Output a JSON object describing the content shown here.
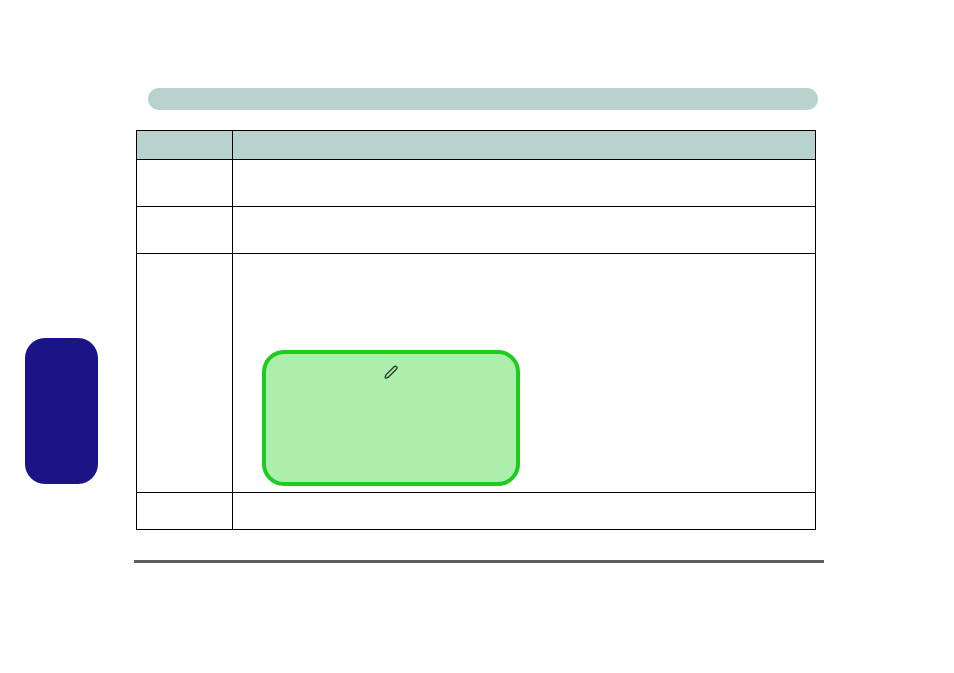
{
  "banner": {
    "label": ""
  },
  "table": {
    "headers": {
      "col1": "",
      "col2": ""
    },
    "rows": [
      {
        "col1": "",
        "col2": ""
      },
      {
        "col1": "",
        "col2": ""
      },
      {
        "col1": "",
        "col2": ""
      },
      {
        "col1": "",
        "col2": ""
      }
    ]
  },
  "side_box": {
    "label": ""
  },
  "note": {
    "text": ""
  },
  "icons": {
    "pen": "pen-icon"
  }
}
